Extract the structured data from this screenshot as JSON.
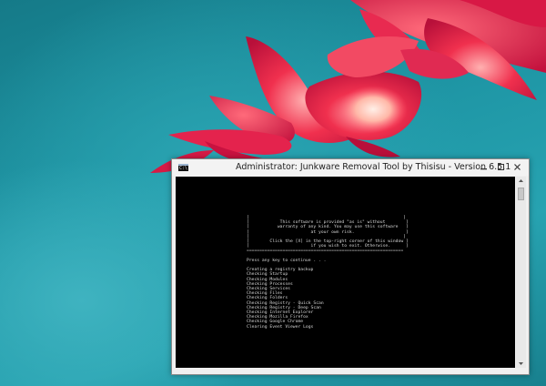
{
  "window": {
    "title": "Administrator:  Junkware Removal Tool by Thisisu - Version 6.5.1",
    "icon": "console-icon"
  },
  "console": {
    "lines": [
      "[                                                            ]",
      "[            This software is provided \"as is\" without        ]",
      "[           warranty of any kind. You may use this software   ]",
      "[                        at your own risk.                    ]",
      "[                                                            ]",
      "[        Click the [X] in the top-right corner of this window ]",
      "[                        if you wish to exit. Otherwise.      ]",
      "=============================================================",
      "",
      "Press any key to continue . . .",
      "",
      "Creating a registry backup",
      "Checking Startup",
      "Checking Modules",
      "Checking Processes",
      "Checking Services",
      "Checking Files",
      "Checking Folders",
      "Checking Registry - Quick Scan",
      "Checking Registry - Deep Scan",
      "Checking Internet Explorer",
      "Checking Mozilla Firefox",
      "Checking Google Chrome",
      "Clearing Event Viewer Logs"
    ]
  },
  "colors": {
    "desktop": "#1f8f9d",
    "flower": "#e8204a",
    "console_bg": "#000000",
    "console_text": "#d8d8d8"
  }
}
